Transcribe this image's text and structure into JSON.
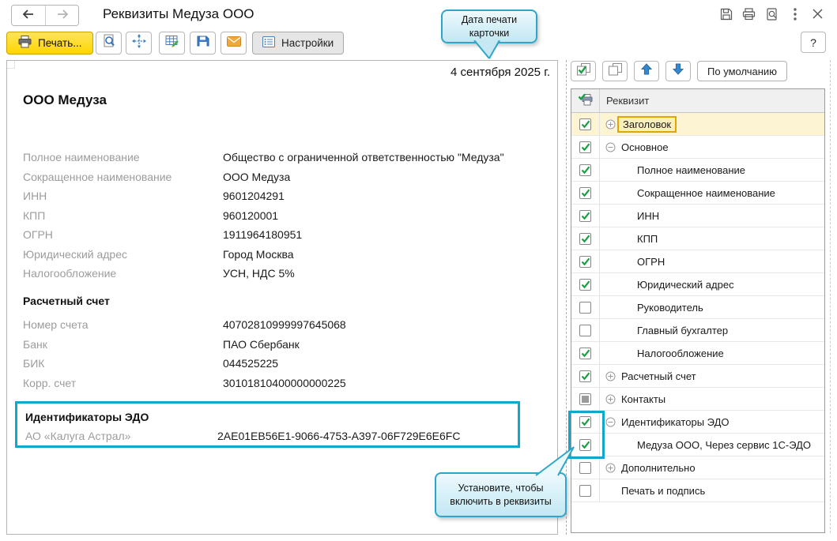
{
  "header": {
    "title": "Реквизиты Медуза ООО",
    "help_label": "?"
  },
  "toolbar": {
    "print_label": "Печать...",
    "settings_label": "Настройки"
  },
  "callouts": {
    "print_date": "Дата печати карточки",
    "enable_hint": "Установите, чтобы включить в реквизиты"
  },
  "document": {
    "date": "4 сентября 2025 г.",
    "company": "ООО Медуза",
    "fields": [
      {
        "label": "Полное наименование",
        "value": "Общество с ограниченной ответственностью \"Медуза\""
      },
      {
        "label": "Сокращенное наименование",
        "value": "ООО Медуза"
      },
      {
        "label": "ИНН",
        "value": "9601204291"
      },
      {
        "label": "КПП",
        "value": "960120001"
      },
      {
        "label": "ОГРН",
        "value": "1911964180951"
      },
      {
        "label": "Юридический адрес",
        "value": "Город Москва"
      },
      {
        "label": "Налогообложение",
        "value": "УСН, НДС 5%"
      }
    ],
    "bank_section": {
      "title": "Расчетный счет",
      "fields": [
        {
          "label": "Номер счета",
          "value": "40702810999997645068"
        },
        {
          "label": "Банк",
          "value": "ПАО Сбербанк"
        },
        {
          "label": "БИК",
          "value": "044525225"
        },
        {
          "label": "Корр. счет",
          "value": "30101810400000000225"
        }
      ]
    },
    "edo_section": {
      "title": "Идентификаторы ЭДО",
      "fields": [
        {
          "label": "АО «Калуга Астрал»",
          "value": "2AE01EB56E1-9066-4753-A397-06F729E6E6FC"
        }
      ]
    }
  },
  "right_panel": {
    "default_button": "По умолчанию",
    "column_header": "Реквизит",
    "rows": [
      {
        "label": "Заголовок",
        "level": 0,
        "state": "checked",
        "expander": "plus",
        "selected": true
      },
      {
        "label": "Основное",
        "level": 0,
        "state": "checked",
        "expander": "minus"
      },
      {
        "label": "Полное наименование",
        "level": 1,
        "state": "checked"
      },
      {
        "label": "Сокращенное наименование",
        "level": 1,
        "state": "checked"
      },
      {
        "label": "ИНН",
        "level": 1,
        "state": "checked"
      },
      {
        "label": "КПП",
        "level": 1,
        "state": "checked"
      },
      {
        "label": "ОГРН",
        "level": 1,
        "state": "checked"
      },
      {
        "label": "Юридический адрес",
        "level": 1,
        "state": "checked"
      },
      {
        "label": "Руководитель",
        "level": 1,
        "state": "unchecked"
      },
      {
        "label": "Главный бухгалтер",
        "level": 1,
        "state": "unchecked"
      },
      {
        "label": "Налогообложение",
        "level": 1,
        "state": "checked"
      },
      {
        "label": "Расчетный счет",
        "level": 0,
        "state": "checked",
        "expander": "plus"
      },
      {
        "label": "Контакты",
        "level": 0,
        "state": "partial",
        "expander": "plus"
      },
      {
        "label": "Идентификаторы ЭДО",
        "level": 0,
        "state": "checked",
        "expander": "minus"
      },
      {
        "label": "Медуза ООО, Через сервис 1С-ЭДО",
        "level": 1,
        "state": "checked"
      },
      {
        "label": "Дополнительно",
        "level": 0,
        "state": "unchecked",
        "expander": "plus"
      },
      {
        "label": "Печать и подпись",
        "level": 0,
        "state": "unchecked"
      }
    ]
  },
  "colors": {
    "teal_highlight": "#10a7ca",
    "selection_yellow": "#fcf4d3",
    "focus_orange": "#e2a600",
    "print_button_yellow": "#ffd600",
    "callout_blue": "#d9f1f9",
    "check_green": "#1c9e45"
  },
  "icons": {
    "back": "arrow-left",
    "forward": "arrow-right",
    "print_button": "printer",
    "toolbar": [
      "page-magnifier-preview",
      "crosshair-move",
      "table-edit",
      "floppy-save",
      "envelope-mail",
      "form-settings"
    ],
    "window": [
      "floppy-save",
      "printer",
      "page-magnifier-preview",
      "kebab-menu",
      "close-x"
    ],
    "right_toolbar": [
      "check-all-sheets",
      "uncheck-all-sheets",
      "arrow-up",
      "arrow-down"
    ],
    "table_header": "printer-with-check"
  }
}
